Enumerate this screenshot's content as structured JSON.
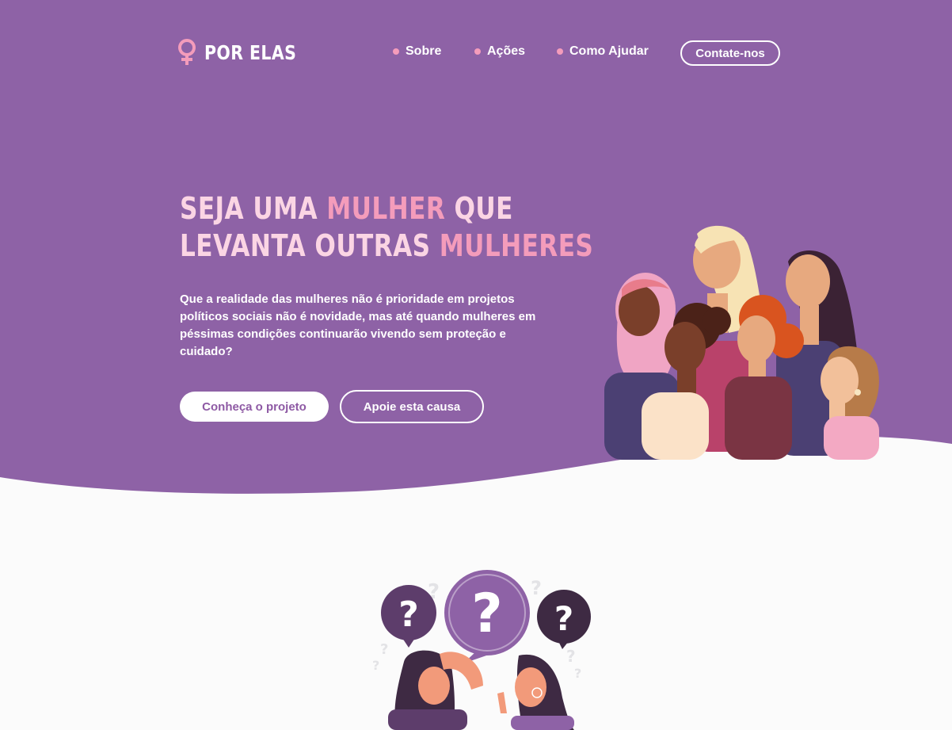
{
  "colors": {
    "hero_bg": "#8e62a6",
    "accent_pink": "#f49cbb",
    "light_pink": "#fbd5e4",
    "page_bg": "#fbfbfb",
    "button_text": "#8e5aa4"
  },
  "brand": {
    "logo_icon": "female-symbol-icon",
    "name": "POR ELAS"
  },
  "nav": {
    "items": [
      {
        "label": "Sobre"
      },
      {
        "label": "Ações"
      },
      {
        "label": "Como Ajudar"
      }
    ],
    "contact_label": "Contate-nos"
  },
  "hero": {
    "headline": {
      "line1_part1": "SEJA UMA ",
      "line1_highlight": "MULHER",
      "line1_part2": " QUE",
      "line2_part1": "LEVANTA OUTRAS ",
      "line2_highlight": "MULHERES"
    },
    "lead": "Que a realidade das mulheres não é prioridade em projetos políticos sociais não é novidade, mas até quando mulheres em péssimas condições continuarão vivendo sem proteção e cuidado?",
    "primary_button": "Conheça o projeto",
    "secondary_button": "Apoie esta causa"
  },
  "illustrations": {
    "hero": "group-of-women-illustration",
    "section": "women-with-question-marks-illustration"
  }
}
